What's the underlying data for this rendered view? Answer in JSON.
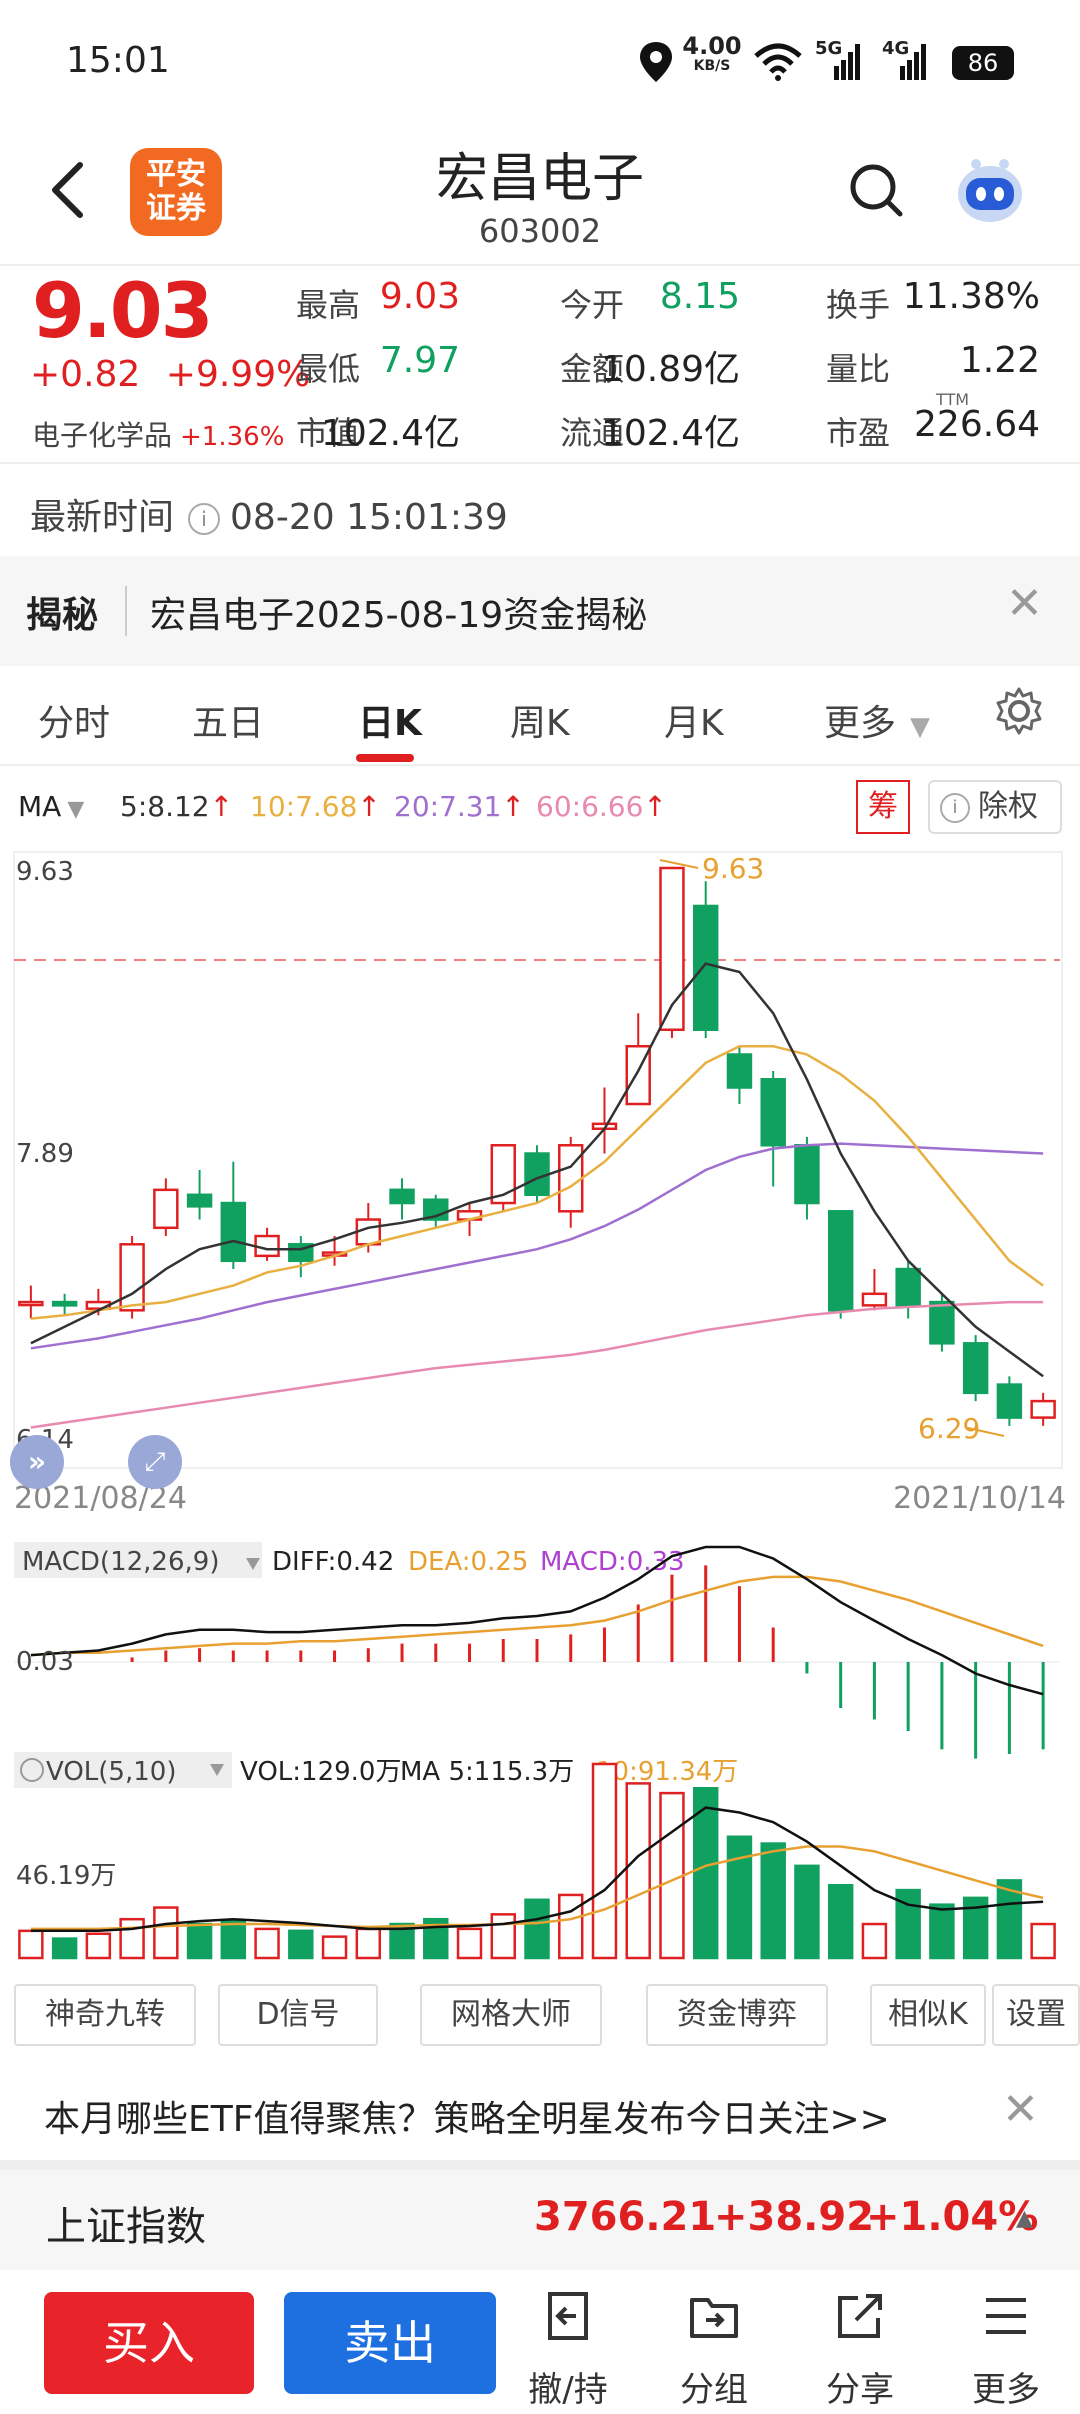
{
  "status_bar": {
    "time": "15:01",
    "speed_top": "4.00",
    "speed_bottom": "KB/S",
    "net1": "5G",
    "net2": "4G",
    "battery": "86"
  },
  "header": {
    "brand_line1": "平安",
    "brand_line2": "证券",
    "title": "宏昌电子",
    "code": "603002"
  },
  "quote": {
    "price": "9.03",
    "change": "+0.82",
    "change_pct": "+9.99%",
    "sector": "电子化学品",
    "sector_pct": "+1.36%",
    "rows": [
      [
        {
          "label": "最高",
          "value": "9.03",
          "color": "red"
        },
        {
          "label": "今开",
          "value": "8.15",
          "color": "green"
        },
        {
          "label": "换手",
          "value": "11.38%",
          "color": "black"
        }
      ],
      [
        {
          "label": "最低",
          "value": "7.97",
          "color": "green"
        },
        {
          "label": "金额",
          "value": "10.89亿",
          "color": "black"
        },
        {
          "label": "量比",
          "value": "1.22",
          "color": "black"
        }
      ],
      [
        {
          "label": "市值",
          "value": "102.4亿",
          "color": "black"
        },
        {
          "label": "流通",
          "value": "102.4亿",
          "color": "black"
        },
        {
          "label": "市盈",
          "value": "226.64",
          "color": "black",
          "sup": "TTM"
        }
      ]
    ]
  },
  "update": {
    "label": "最新时间",
    "timestamp": "08-20 15:01:39"
  },
  "reveal": {
    "tag": "揭秘",
    "text": "宏昌电子2025-08-19资金揭秘"
  },
  "tabs": [
    "分时",
    "五日",
    "日K",
    "周K",
    "月K",
    "更多"
  ],
  "active_tab": "日K",
  "ma": {
    "label": "MA",
    "ma5": "5:8.12",
    "ma10": "10:7.68",
    "ma20": "20:7.31",
    "ma60": "60:6.66",
    "chip_button": "筹",
    "exright_button": "除权"
  },
  "kline_labels": {
    "ymax": "9.63",
    "ymid": "7.89",
    "ymin": "6.14",
    "high_mark": "9.63",
    "low_mark": "6.29",
    "date_start": "2021/08/24",
    "date_end": "2021/10/14"
  },
  "macd": {
    "label": "MACD(12,26,9)",
    "diff": "DIFF:0.42",
    "dea": "DEA:0.25",
    "macd": "MACD:0.33",
    "level": "0.03"
  },
  "vol": {
    "label": "VOL(5,10)",
    "vol": "VOL:129.0万",
    "ma5": "MA 5:115.3万",
    "ma10": "10:91.34万",
    "level": "46.19万"
  },
  "features": [
    "神奇九转",
    "D信号",
    "网格大师",
    "资金博弈",
    "相似K",
    "设置"
  ],
  "ad": {
    "text": "本月哪些ETF值得聚焦？策略全明星发布今日关注>>"
  },
  "index": {
    "name": "上证指数",
    "value": "3766.21",
    "change": "+38.92",
    "pct": "+1.04%"
  },
  "bottom": {
    "buy": "买入",
    "sell": "卖出",
    "icons": [
      "撤/持",
      "分组",
      "分享",
      "更多"
    ]
  },
  "colors": {
    "up": "#e02020",
    "down": "#10a060",
    "ma5": "#333333",
    "ma10": "#e8b040",
    "ma20": "#a070d0",
    "ma60": "#e88ab0",
    "buy": "#e8242a",
    "sell": "#1e6fe0",
    "brand": "#f26a21"
  },
  "chart_data": {
    "type": "candlestick",
    "ylim": [
      6.14,
      9.63
    ],
    "candles": [
      {
        "o": 7.0,
        "c": 7.0,
        "h": 7.1,
        "l": 6.9
      },
      {
        "o": 7.0,
        "c": 6.98,
        "h": 7.05,
        "l": 6.92
      },
      {
        "o": 6.96,
        "c": 7.0,
        "h": 7.08,
        "l": 6.92
      },
      {
        "o": 6.95,
        "c": 7.35,
        "h": 7.4,
        "l": 6.9
      },
      {
        "o": 7.45,
        "c": 7.68,
        "h": 7.75,
        "l": 7.4
      },
      {
        "o": 7.65,
        "c": 7.58,
        "h": 7.8,
        "l": 7.5
      },
      {
        "o": 7.6,
        "c": 7.25,
        "h": 7.85,
        "l": 7.2
      },
      {
        "o": 7.28,
        "c": 7.4,
        "h": 7.45,
        "l": 7.25
      },
      {
        "o": 7.35,
        "c": 7.25,
        "h": 7.4,
        "l": 7.15
      },
      {
        "o": 7.3,
        "c": 7.3,
        "h": 7.4,
        "l": 7.22
      },
      {
        "o": 7.35,
        "c": 7.5,
        "h": 7.6,
        "l": 7.3
      },
      {
        "o": 7.68,
        "c": 7.6,
        "h": 7.75,
        "l": 7.5
      },
      {
        "o": 7.62,
        "c": 7.5,
        "h": 7.65,
        "l": 7.45
      },
      {
        "o": 7.5,
        "c": 7.55,
        "h": 7.6,
        "l": 7.4
      },
      {
        "o": 7.6,
        "c": 7.95,
        "h": 7.95,
        "l": 7.55
      },
      {
        "o": 7.9,
        "c": 7.65,
        "h": 7.95,
        "l": 7.6
      },
      {
        "o": 7.55,
        "c": 7.95,
        "h": 8.0,
        "l": 7.45
      },
      {
        "o": 8.05,
        "c": 8.08,
        "h": 8.3,
        "l": 7.9
      },
      {
        "o": 8.2,
        "c": 8.55,
        "h": 8.75,
        "l": 8.2
      },
      {
        "o": 8.65,
        "c": 9.63,
        "h": 9.63,
        "l": 8.6
      },
      {
        "o": 9.4,
        "c": 8.65,
        "h": 9.55,
        "l": 8.6
      },
      {
        "o": 8.5,
        "c": 8.3,
        "h": 8.55,
        "l": 8.2
      },
      {
        "o": 8.35,
        "c": 7.95,
        "h": 8.4,
        "l": 7.7
      },
      {
        "o": 7.95,
        "c": 7.6,
        "h": 8.0,
        "l": 7.5
      },
      {
        "o": 7.55,
        "c": 6.95,
        "h": 7.55,
        "l": 6.9
      },
      {
        "o": 6.98,
        "c": 7.05,
        "h": 7.2,
        "l": 6.95
      },
      {
        "o": 7.2,
        "c": 6.98,
        "h": 7.25,
        "l": 6.9
      },
      {
        "o": 7.0,
        "c": 6.75,
        "h": 7.05,
        "l": 6.7
      },
      {
        "o": 6.75,
        "c": 6.45,
        "h": 6.8,
        "l": 6.4
      },
      {
        "o": 6.5,
        "c": 6.3,
        "h": 6.55,
        "l": 6.25
      },
      {
        "o": 6.3,
        "c": 6.4,
        "h": 6.45,
        "l": 6.25
      }
    ],
    "ma5": [
      6.75,
      6.85,
      6.95,
      7.05,
      7.2,
      7.32,
      7.37,
      7.32,
      7.32,
      7.38,
      7.45,
      7.48,
      7.52,
      7.6,
      7.65,
      7.75,
      7.82,
      8.05,
      8.4,
      8.8,
      9.05,
      9.0,
      8.75,
      8.35,
      7.9,
      7.55,
      7.25,
      7.05,
      6.85,
      6.7,
      6.55
    ],
    "ma10": [
      6.9,
      6.92,
      6.95,
      6.98,
      7.0,
      7.05,
      7.1,
      7.18,
      7.22,
      7.28,
      7.35,
      7.4,
      7.45,
      7.5,
      7.55,
      7.6,
      7.7,
      7.85,
      8.05,
      8.25,
      8.45,
      8.55,
      8.55,
      8.5,
      8.38,
      8.22,
      8.0,
      7.75,
      7.5,
      7.25,
      7.1
    ],
    "ma20": [
      6.72,
      6.75,
      6.78,
      6.82,
      6.86,
      6.9,
      6.95,
      7.0,
      7.04,
      7.08,
      7.12,
      7.16,
      7.2,
      7.24,
      7.28,
      7.32,
      7.38,
      7.46,
      7.56,
      7.68,
      7.8,
      7.88,
      7.93,
      7.95,
      7.96,
      7.95,
      7.94,
      7.93,
      7.92,
      7.91,
      7.9
    ],
    "ma60": [
      6.24,
      6.27,
      6.3,
      6.33,
      6.36,
      6.39,
      6.42,
      6.45,
      6.48,
      6.51,
      6.54,
      6.57,
      6.6,
      6.62,
      6.64,
      6.66,
      6.68,
      6.71,
      6.75,
      6.79,
      6.83,
      6.86,
      6.89,
      6.92,
      6.94,
      6.96,
      6.97,
      6.98,
      6.99,
      7.0,
      7.0
    ],
    "macd_bars": [
      0.0,
      0.0,
      0.0,
      0.02,
      0.05,
      0.06,
      0.05,
      0.05,
      0.05,
      0.05,
      0.06,
      0.08,
      0.08,
      0.08,
      0.1,
      0.1,
      0.12,
      0.15,
      0.25,
      0.38,
      0.42,
      0.33,
      0.15,
      -0.05,
      -0.2,
      -0.25,
      -0.3,
      -0.38,
      -0.42,
      -0.4,
      -0.38
    ],
    "macd_diff": [
      0.03,
      0.04,
      0.05,
      0.08,
      0.12,
      0.14,
      0.14,
      0.13,
      0.13,
      0.14,
      0.15,
      0.16,
      0.16,
      0.17,
      0.19,
      0.2,
      0.22,
      0.28,
      0.36,
      0.46,
      0.5,
      0.5,
      0.45,
      0.36,
      0.26,
      0.18,
      0.1,
      0.03,
      -0.05,
      -0.1,
      -0.14
    ],
    "macd_dea": [
      0.03,
      0.04,
      0.04,
      0.05,
      0.06,
      0.07,
      0.08,
      0.08,
      0.09,
      0.09,
      0.1,
      0.11,
      0.12,
      0.13,
      0.14,
      0.15,
      0.16,
      0.18,
      0.22,
      0.27,
      0.31,
      0.35,
      0.37,
      0.37,
      0.35,
      0.31,
      0.27,
      0.22,
      0.17,
      0.12,
      0.07
    ],
    "vol": [
      28,
      20,
      25,
      40,
      52,
      35,
      38,
      30,
      28,
      22,
      30,
      35,
      40,
      30,
      45,
      60,
      65,
      200,
      180,
      170,
      175,
      125,
      118,
      95,
      75,
      35,
      70,
      55,
      62,
      80,
      35
    ],
    "vol_ma5": [
      28,
      28,
      28,
      30,
      35,
      38,
      40,
      38,
      36,
      33,
      30,
      30,
      32,
      33,
      35,
      40,
      48,
      70,
      105,
      130,
      155,
      150,
      140,
      120,
      95,
      70,
      55,
      50,
      52,
      56,
      58
    ],
    "vol_ma10": [
      30,
      30,
      30,
      31,
      33,
      34,
      35,
      35,
      34,
      33,
      32,
      33,
      34,
      34,
      35,
      36,
      40,
      50,
      65,
      80,
      95,
      103,
      110,
      115,
      115,
      110,
      100,
      90,
      80,
      70,
      62
    ]
  }
}
